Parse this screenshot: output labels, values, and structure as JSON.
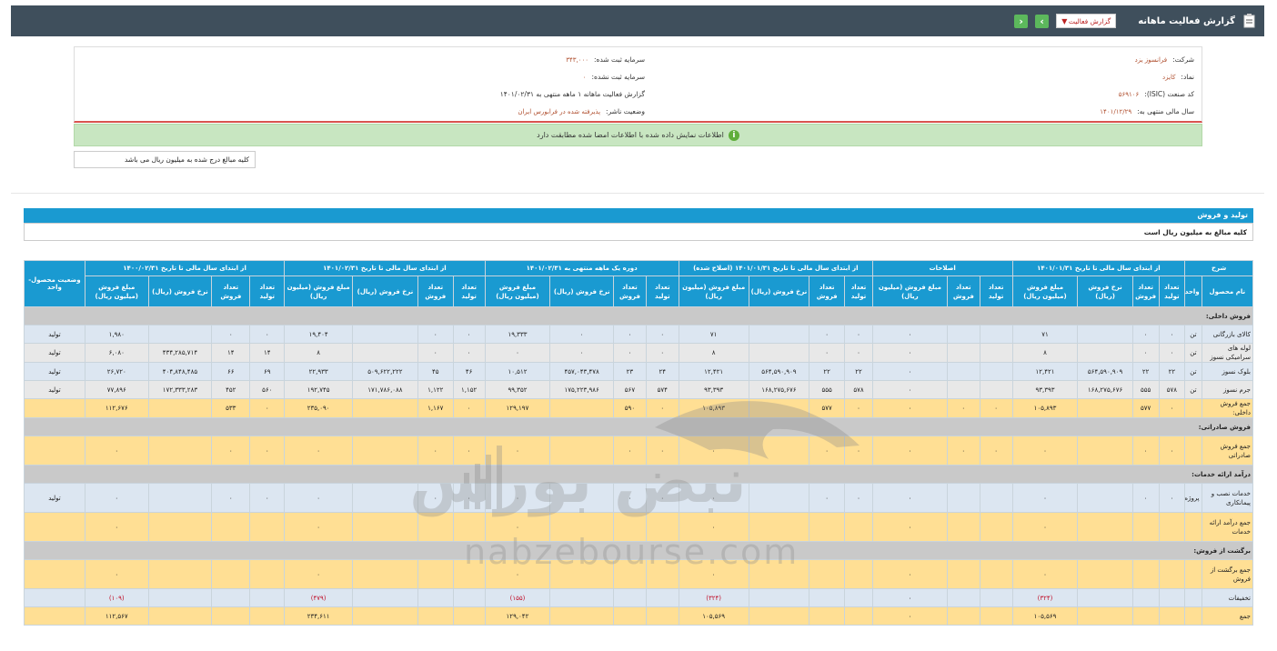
{
  "topbar": {
    "title": "گزارش فعالیت ماهانه",
    "select_value": "گزارش فعالیت",
    "next": "‹",
    "prev": "›"
  },
  "info": {
    "right": [
      {
        "label": "شرکت:",
        "value": "فرانسوز یزد"
      },
      {
        "label": "نماد:",
        "value": "کایزد"
      },
      {
        "label": "کد صنعت (ISIC):",
        "value": "۵۶۹۱۰۶"
      },
      {
        "label": "سال مالی منتهی به:",
        "value": "۱۴۰۱/۱۲/۲۹"
      }
    ],
    "left": [
      {
        "label": "سرمایه ثبت شده:",
        "value": "۳۴۳,۰۰۰"
      },
      {
        "label": "سرمایه ثبت نشده:",
        "value": "۰"
      },
      {
        "label": "گزارش فعالیت ماهانه ۱ ماهه منتهی به ۱۴۰۱/۰۲/۳۱",
        "value": ""
      },
      {
        "label": "وضعیت ناشر:",
        "value": "پذیرفته شده در فرابورس ایران"
      }
    ]
  },
  "alert": "اطلاعات نمایش داده شده با اطلاعات امضا شده مطابقت دارد",
  "note": "کلیه مبالغ درج شده به میلیون ریال می باشد",
  "section": {
    "title": "تولید و فروش",
    "subtitle": "کلیه مبالغ به میلیون ریال است"
  },
  "table": {
    "groups": [
      "شرح",
      "از ابتدای سال مالی تا تاریخ ۱۴۰۱/۰۱/۳۱",
      "اصلاحات",
      "از ابتدای سال مالی تا تاریخ ۱۴۰۱/۰۱/۳۱ (اصلاح شده)",
      "دوره یک ماهه منتهی به ۱۴۰۱/۰۲/۳۱",
      "از ابتدای سال مالی تا تاریخ ۱۴۰۱/۰۲/۳۱",
      "از ابتدای سال مالی تا تاریخ ۱۴۰۰/۰۲/۳۱",
      "وضعیت محصول- واحد"
    ],
    "sub": [
      "نام محصول",
      "واحد",
      "تعداد تولید",
      "تعداد فروش",
      "نرخ فروش (ریال)",
      "مبلغ فروش (میلیون ریال)",
      "تعداد تولید",
      "تعداد فروش",
      "مبلغ فروش (میلیون ریال)",
      "تعداد تولید",
      "تعداد فروش",
      "نرخ فروش (ریال)",
      "مبلغ فروش (میلیون ریال)",
      "تعداد تولید",
      "تعداد فروش",
      "نرخ فروش (ریال)",
      "مبلغ فروش (میلیون ریال)",
      "تعداد تولید",
      "تعداد فروش",
      "نرخ فروش (ریال)",
      "مبلغ فروش (میلیون ریال)",
      "تعداد تولید",
      "تعداد فروش",
      "نرخ فروش (ریال)",
      "مبلغ فروش (میلیون ریال)"
    ],
    "rows": [
      {
        "type": "secrow",
        "cells": [
          "فروش داخلی:"
        ]
      },
      {
        "type": "r-blue",
        "cells": [
          "کالای بازرگانی",
          "تن",
          "۰",
          "۰",
          "",
          "۷۱",
          "",
          "",
          "۰",
          "۰",
          "۰",
          "",
          "۷۱",
          "۰",
          "۰",
          "۰",
          "۱۹,۳۳۳",
          "۰",
          "۰",
          "",
          "۱۹,۴۰۴",
          "۰",
          "۰",
          "",
          "۱,۹۸۰",
          "تولید"
        ]
      },
      {
        "type": "r-grey",
        "cells": [
          "لوله های سرامیکی نسوز",
          "تن",
          "۰",
          "۰",
          "",
          "۸",
          "",
          "",
          "۰",
          "۰",
          "۰",
          "",
          "۸",
          "۰",
          "۰",
          "۰",
          "۰",
          "۰",
          "۰",
          "",
          "۸",
          "۱۴",
          "۱۴",
          "۴۳۴,۲۸۵,۷۱۴",
          "۶,۰۸۰",
          "تولید"
        ]
      },
      {
        "type": "r-blue",
        "cells": [
          "بلوک نسوز",
          "تن",
          "۲۲",
          "۲۲",
          "۵۶۴,۵۹۰,۹۰۹",
          "۱۲,۴۲۱",
          "",
          "",
          "۰",
          "۲۲",
          "۲۲",
          "۵۶۴,۵۹۰,۹۰۹",
          "۱۲,۴۲۱",
          "۲۴",
          "۲۳",
          "۴۵۷,۰۴۳,۴۷۸",
          "۱۰,۵۱۲",
          "۴۶",
          "۴۵",
          "۵۰۹,۶۲۲,۲۲۲",
          "۲۲,۹۳۳",
          "۶۹",
          "۶۶",
          "۴۰۴,۸۴۸,۴۸۵",
          "۲۶,۷۲۰",
          "تولید"
        ]
      },
      {
        "type": "r-grey",
        "cells": [
          "جرم نسوز",
          "تن",
          "۵۷۸",
          "۵۵۵",
          "۱۶۸,۲۷۵,۶۷۶",
          "۹۳,۳۹۳",
          "",
          "",
          "۰",
          "۵۷۸",
          "۵۵۵",
          "۱۶۸,۲۷۵,۶۷۶",
          "۹۳,۳۹۳",
          "۵۷۴",
          "۵۶۷",
          "۱۷۵,۲۲۳,۹۸۶",
          "۹۹,۳۵۲",
          "۱,۱۵۲",
          "۱,۱۲۲",
          "۱۷۱,۷۸۶,۰۸۸",
          "۱۹۲,۷۴۵",
          "۵۶۰",
          "۴۵۲",
          "۱۷۲,۳۳۳,۲۸۳",
          "۷۷,۸۹۶",
          "تولید"
        ]
      },
      {
        "type": "r-tot",
        "cells": [
          "جمع فروش داخلی:",
          "",
          "۰",
          "۵۷۷",
          "",
          "۱۰۵,۸۹۳",
          "۰",
          "۰",
          "۰",
          "۰",
          "۵۷۷",
          "",
          "۱۰۵,۸۹۳",
          "۰",
          "۵۹۰",
          "",
          "۱۲۹,۱۹۷",
          "۰",
          "۱,۱۶۷",
          "",
          "۲۳۵,۰۹۰",
          "۰",
          "۵۳۳",
          "",
          "۱۱۲,۶۷۶",
          ""
        ]
      },
      {
        "type": "secrow",
        "cells": [
          "فروش صادراتی:"
        ]
      },
      {
        "type": "r-tot tall",
        "cells": [
          "جمع فروش صادراتی",
          "",
          "۰",
          "۰",
          "",
          "۰",
          "۰",
          "۰",
          "۰",
          "۰",
          "۰",
          "",
          "۰",
          "۰",
          "۰",
          "",
          "۰",
          "۰",
          "۰",
          "",
          "۰",
          "۰",
          "۰",
          "",
          "۰",
          ""
        ]
      },
      {
        "type": "secrow",
        "cells": [
          "درآمد ارائه خدمات:"
        ]
      },
      {
        "type": "r-blue tall",
        "cells": [
          "خدمات نصب و پیمانکاری",
          "پروژه",
          "۰",
          "۰",
          "",
          "۰",
          "",
          "",
          "۰",
          "۰",
          "۰",
          "",
          "۰",
          "۰",
          "۰",
          "",
          "۰",
          "۰",
          "۰",
          "",
          "۰",
          "۰",
          "۰",
          "",
          "۰",
          "تولید"
        ]
      },
      {
        "type": "r-tot tall",
        "cells": [
          "جمع درآمد ارائه خدمات",
          "",
          "",
          "",
          "",
          "۰",
          "",
          "",
          "۰",
          "",
          "",
          "",
          "۰",
          "",
          "",
          "",
          "۰",
          "",
          "",
          "",
          "۰",
          "",
          "",
          "",
          "۰",
          ""
        ]
      },
      {
        "type": "secrow",
        "cells": [
          "برگشت از فروش:"
        ]
      },
      {
        "type": "r-tot tall",
        "cells": [
          "جمع برگشت از فروش",
          "",
          "",
          "",
          "",
          "۰",
          "",
          "",
          "۰",
          "",
          "",
          "",
          "۰",
          "",
          "",
          "",
          "۰",
          "",
          "",
          "",
          "۰",
          "",
          "",
          "",
          "۰",
          ""
        ]
      },
      {
        "type": "r-blue",
        "cells": [
          "تخفیفات",
          "",
          "",
          "",
          "",
          "(۳۲۴)",
          "",
          "",
          "۰",
          "",
          "",
          "",
          "(۳۲۴)",
          "",
          "",
          "",
          "(۱۵۵)",
          "",
          "",
          "",
          "(۴۷۹)",
          "",
          "",
          "",
          "(۱۰۹)",
          ""
        ]
      },
      {
        "type": "r-tot",
        "cells": [
          "جمع",
          "",
          "",
          "",
          "",
          "۱۰۵,۵۶۹",
          "",
          "",
          "۰",
          "",
          "",
          "",
          "۱۰۵,۵۶۹",
          "",
          "",
          "",
          "۱۲۹,۰۴۲",
          "",
          "",
          "",
          "۲۳۴,۶۱۱",
          "",
          "",
          "",
          "۱۱۲,۵۶۷",
          ""
        ]
      }
    ]
  },
  "watermark": {
    "site": "nabzebourse.com",
    "brand": "نبض بورس"
  },
  "colors": {
    "header": "#3f4f5c",
    "table_head": "#1a9ad1",
    "total_row": "#ffdf94",
    "alert": "#c8e6c1"
  }
}
